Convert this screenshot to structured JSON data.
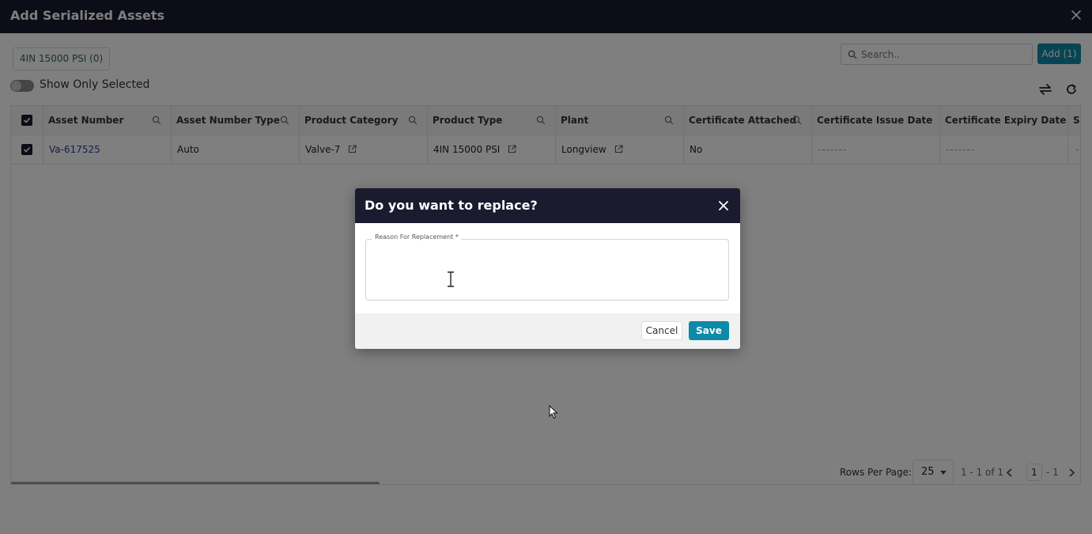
{
  "window": {
    "title": "Add Serialized Assets"
  },
  "toolbar": {
    "chip_label": "4IN 15000 PSI (0)",
    "search_placeholder": "Search..",
    "add_label": "Add (1)",
    "toggle_label": "Show Only Selected",
    "toggle_on": false
  },
  "table": {
    "columns": [
      "Asset Number",
      "Asset Number Type",
      "Product Category",
      "Product Type",
      "Plant",
      "Certificate Attached",
      "Certificate Issue Date",
      "Certificate Expiry Date",
      "Sc"
    ],
    "rows": [
      {
        "selected": true,
        "asset_number": "Va-617525",
        "asset_number_type": "Auto",
        "product_category": "Valve-7",
        "product_type": "4IN 15000 PSI",
        "plant": "Longview",
        "certificate_attached": "No",
        "certificate_issue_date": "-------",
        "certificate_expiry_date": "-------",
        "sc": "-"
      }
    ]
  },
  "pagination": {
    "rows_per_page_label": "Rows Per Page:",
    "rows_per_page": "25",
    "range": "1 - 1 of 1",
    "page": "1",
    "page_total": "- 1"
  },
  "dialog": {
    "title": "Do you want to replace?",
    "field_label": "Reason For Replacement *",
    "field_value": "",
    "cancel_label": "Cancel",
    "save_label": "Save"
  },
  "colors": {
    "header_bg": "#1b1b2f",
    "accent": "#0c8aa8",
    "chip_text": "#2f6b4a",
    "link": "#2a3d8f"
  }
}
